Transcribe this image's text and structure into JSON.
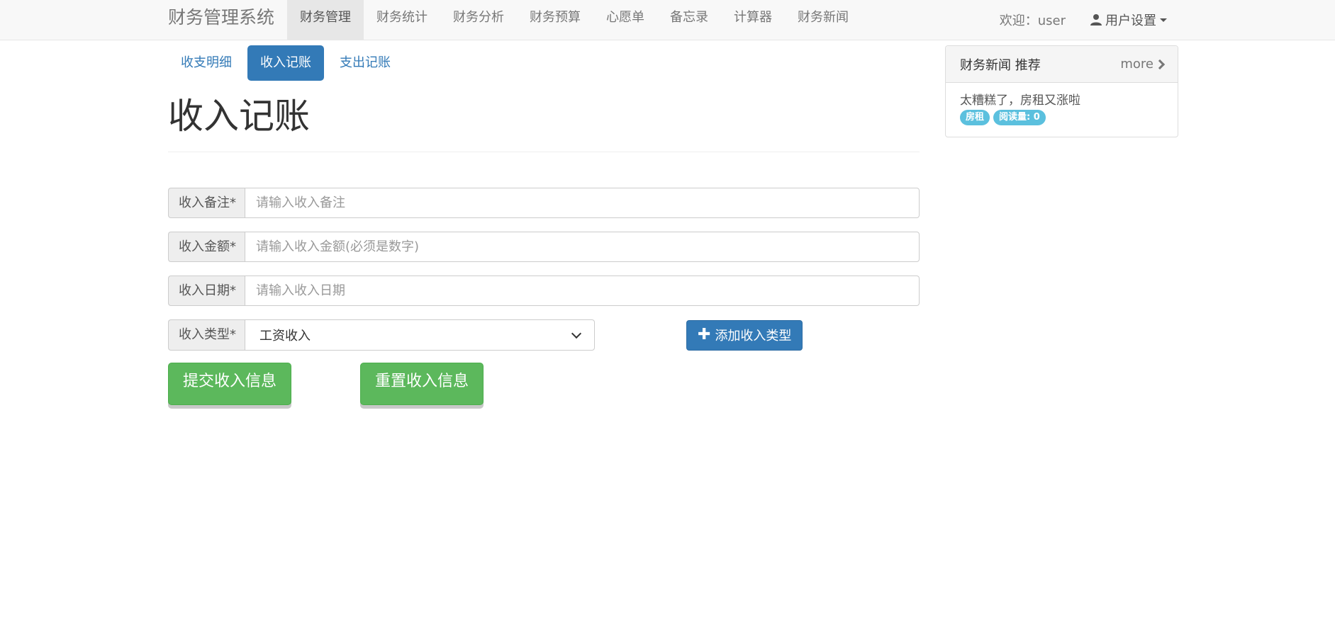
{
  "navbar": {
    "brand": "财务管理系统",
    "items": [
      {
        "label": "财务管理",
        "active": true
      },
      {
        "label": "财务统计"
      },
      {
        "label": "财务分析"
      },
      {
        "label": "财务预算"
      },
      {
        "label": "心愿单"
      },
      {
        "label": "备忘录"
      },
      {
        "label": "计算器"
      },
      {
        "label": "财务新闻"
      }
    ],
    "welcome": "欢迎：user",
    "user_menu": "用户设置",
    "user_icon": "user-icon"
  },
  "tabs": [
    {
      "label": "收支明细"
    },
    {
      "label": "收入记账",
      "active": true
    },
    {
      "label": "支出记账"
    }
  ],
  "page_title": "收入记账",
  "form": {
    "note_label": "收入备注*",
    "note_placeholder": "请输入收入备注",
    "amount_label": "收入金额*",
    "amount_placeholder": "请输入收入金额(必须是数字)",
    "date_label": "收入日期*",
    "date_placeholder": "请输入收入日期",
    "type_label": "收入类型*",
    "type_selected": "工资收入",
    "add_type_button": "添加收入类型",
    "submit_button": "提交收入信息",
    "reset_button": "重置收入信息"
  },
  "news_panel": {
    "title": "财务新闻 推荐",
    "more": "more",
    "items": [
      {
        "title": "太糟糕了，房租又涨啦",
        "tag": "房租",
        "reads": "阅读量: 0"
      }
    ]
  },
  "colors": {
    "primary": "#337ab7",
    "success": "#5cb85c",
    "info": "#5bc0de"
  }
}
